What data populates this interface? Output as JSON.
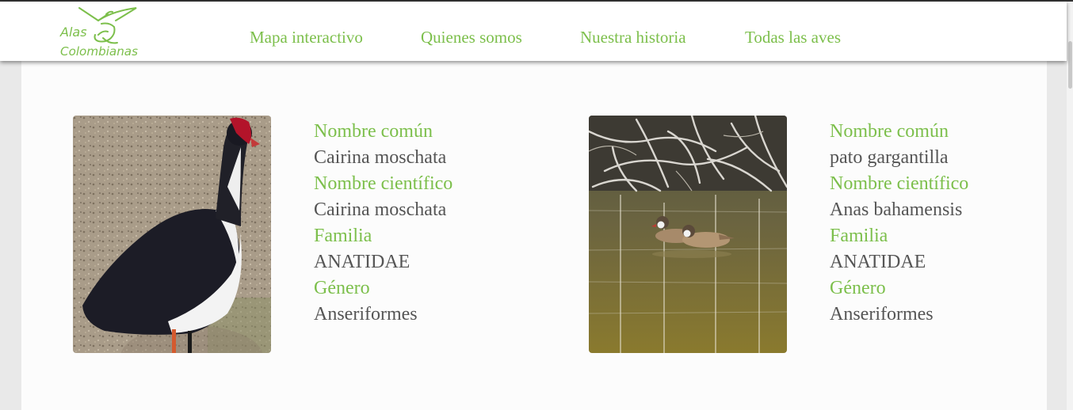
{
  "brand": {
    "line1": "Alas",
    "line2": "Colombianas",
    "color": "#7cbf4b"
  },
  "nav": {
    "items": [
      {
        "label": "Mapa interactivo"
      },
      {
        "label": "Quienes somos"
      },
      {
        "label": "Nuestra historia"
      },
      {
        "label": "Todas las aves"
      }
    ]
  },
  "colors": {
    "accent": "#7cbf4b",
    "text": "#555555",
    "background": "#e9e9e9",
    "panel": "#fcfcfc"
  },
  "labels": {
    "common_name": "Nombre común",
    "scientific_name": "Nombre científico",
    "family": "Familia",
    "genus": "Género"
  },
  "birds": [
    {
      "common_name": "Cairina moschata",
      "scientific_name": "Cairina moschata",
      "family": "ANATIDAE",
      "genus": "Anseriformes",
      "image_icon": "muscovy-duck-photo"
    },
    {
      "common_name": "pato gargantilla",
      "scientific_name": "Anas bahamensis",
      "family": "ANATIDAE",
      "genus": "Anseriformes",
      "image_icon": "white-cheeked-pintail-photo"
    }
  ]
}
